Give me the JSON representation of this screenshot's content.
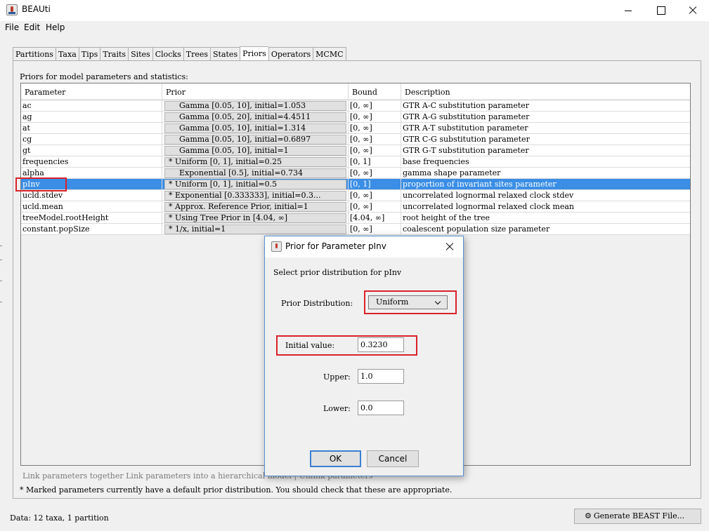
{
  "window": {
    "title": "BEAUti"
  },
  "menu": [
    "File",
    "Edit",
    "Help"
  ],
  "tabs": [
    "Partitions",
    "Taxa",
    "Tips",
    "Traits",
    "Sites",
    "Clocks",
    "Trees",
    "States",
    "Priors",
    "Operators",
    "MCMC"
  ],
  "active_tab": "Priors",
  "priors_heading": "Priors for model parameters and statistics:",
  "columns": {
    "parameter": "Parameter",
    "prior": "Prior",
    "bound": "Bound",
    "description": "Description"
  },
  "rows": [
    {
      "param": "ac",
      "prior": "Gamma [0.05, 10], initial=1.053",
      "marked": false,
      "bound": "[0, ∞]",
      "desc": "GTR A-C substitution parameter"
    },
    {
      "param": "ag",
      "prior": "Gamma [0.05, 20], initial=4.4511",
      "marked": false,
      "bound": "[0, ∞]",
      "desc": "GTR A-G substitution parameter"
    },
    {
      "param": "at",
      "prior": "Gamma [0.05, 10], initial=1.314",
      "marked": false,
      "bound": "[0, ∞]",
      "desc": "GTR A-T substitution parameter"
    },
    {
      "param": "cg",
      "prior": "Gamma [0.05, 10], initial=0.6897",
      "marked": false,
      "bound": "[0, ∞]",
      "desc": "GTR C-G substitution parameter"
    },
    {
      "param": "gt",
      "prior": "Gamma [0.05, 10], initial=1",
      "marked": false,
      "bound": "[0, ∞]",
      "desc": "GTR G-T substitution parameter"
    },
    {
      "param": "frequencies",
      "prior": "* Uniform [0, 1], initial=0.25",
      "marked": true,
      "bound": "[0, 1]",
      "desc": "base frequencies"
    },
    {
      "param": "alpha",
      "prior": "Exponential [0.5], initial=0.734",
      "marked": false,
      "bound": "[0, ∞]",
      "desc": "gamma shape parameter"
    },
    {
      "param": "pInv",
      "prior": "* Uniform [0, 1], initial=0.5",
      "marked": true,
      "bound": "[0, 1]",
      "desc": "proportion of invariant sites parameter",
      "selected": true
    },
    {
      "param": "ucld.stdev",
      "prior": "* Exponential [0.333333], initial=0.3...",
      "marked": true,
      "bound": "[0, ∞]",
      "desc": "uncorrelated lognormal relaxed clock stdev"
    },
    {
      "param": "ucld.mean",
      "prior": "* Approx. Reference Prior, initial=1",
      "marked": true,
      "bound": "[0, ∞]",
      "desc": "uncorrelated lognormal relaxed clock mean"
    },
    {
      "param": "treeModel.rootHeight",
      "prior": "* Using Tree Prior in [4.04, ∞]",
      "marked": true,
      "bound": "[4.04, ∞]",
      "desc": "root height of the tree"
    },
    {
      "param": "constant.popSize",
      "prior": "* 1/x, initial=1",
      "marked": true,
      "bound": "[0, ∞]",
      "desc": "coalescent population size parameter"
    }
  ],
  "link_info": "Link parameters together Link parameters into a hierarchical model | Unlink parameters",
  "marked_note": "* Marked parameters currently have a default prior distribution. You should check that these are appropriate.",
  "status": "Data: 12 taxa, 1 partition",
  "generate_button": "Generate BEAST File...",
  "dialog": {
    "title": "Prior for Parameter pInv",
    "instruction": "Select prior distribution for pInv",
    "dist_label": "Prior Distribution:",
    "dist_value": "Uniform",
    "initial_label": "Initial value:",
    "initial_value": "0.3230",
    "upper_label": "Upper:",
    "upper_value": "1.0",
    "lower_label": "Lower:",
    "lower_value": "0.0",
    "ok": "OK",
    "cancel": "Cancel"
  },
  "highlight_color": "#d8232a",
  "selection_color": "#3a8ee6"
}
